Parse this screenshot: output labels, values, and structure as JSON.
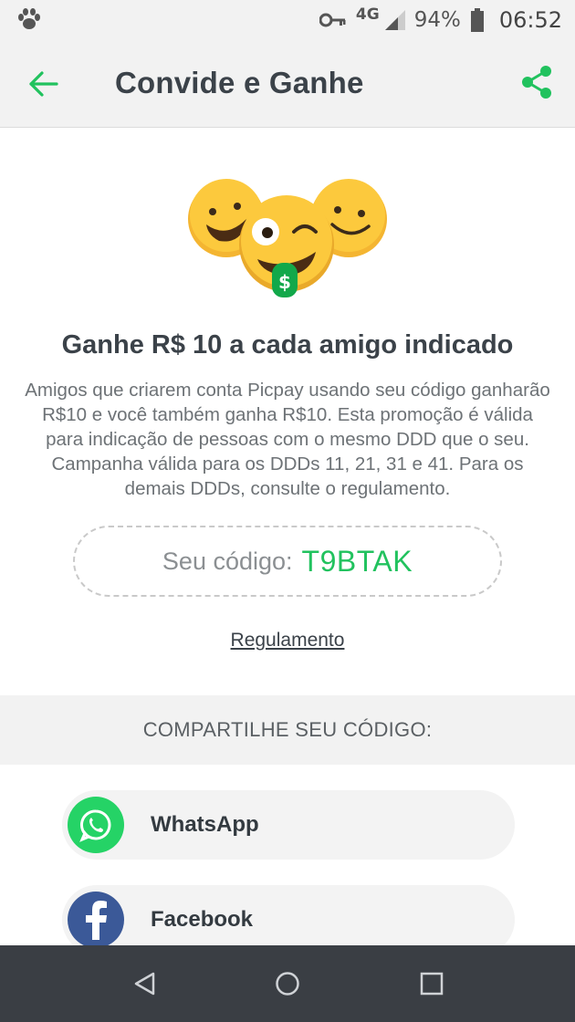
{
  "status_bar": {
    "network": "4G",
    "battery": "94%",
    "time": "06:52"
  },
  "app_bar": {
    "title": "Convide e Ganhe"
  },
  "hero": {
    "headline": "Ganhe R$ 10 a cada amigo indicado",
    "description": "Amigos que criarem conta Picpay usando seu código ganharão R$10 e você também ganha R$10. Esta promoção é válida para indicação de pessoas com o mesmo DDD que o seu. Campanha válida para os DDDs 11, 21, 31 e 41. Para os demais DDDs, consulte o regulamento.",
    "money_symbol": "$"
  },
  "referral": {
    "code_label": "Seu código:",
    "code_value": "T9BTAK",
    "rules_link": "Regulamento"
  },
  "share": {
    "header": "COMPARTILHE SEU CÓDIGO:",
    "options": [
      {
        "label": "WhatsApp",
        "icon": "whatsapp-icon",
        "color": "#25d366"
      },
      {
        "label": "Facebook",
        "icon": "facebook-icon",
        "color": "#3b5998"
      }
    ]
  },
  "colors": {
    "accent": "#21c25e",
    "nav_bar": "#3a3e44"
  }
}
